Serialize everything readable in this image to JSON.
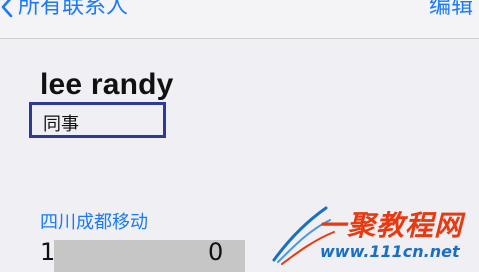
{
  "nav": {
    "back_label": "所有联系人",
    "edit_label": "编辑"
  },
  "contact": {
    "name": "lee randy",
    "relation": "同事"
  },
  "phone": {
    "label": "四川成都移动",
    "first_digit": "1",
    "last_digit": "0"
  },
  "watermark": {
    "title": "一聚教程网",
    "url": "www.111cn.net"
  },
  "colors": {
    "accent": "#1a7af8",
    "highlight_box": "#2e3a98",
    "redaction": "#c6c6c6",
    "watermark_red": "#e83a10",
    "watermark_blue": "#1b6fc0"
  }
}
